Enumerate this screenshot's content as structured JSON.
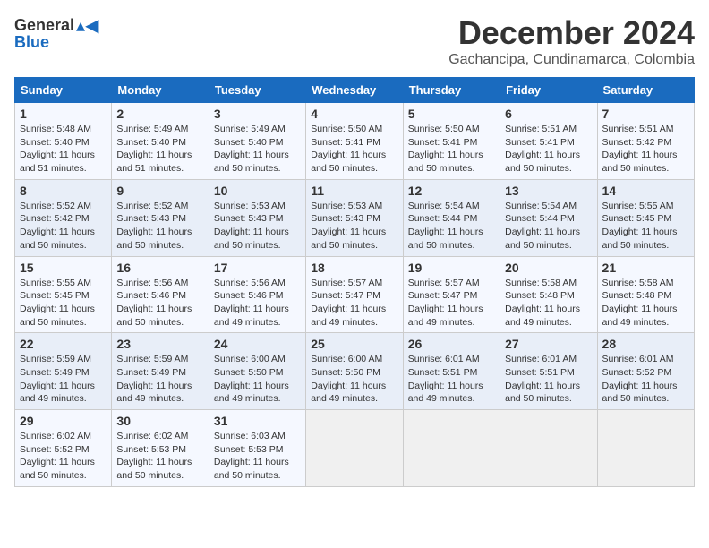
{
  "logo": {
    "general": "General",
    "blue": "Blue"
  },
  "header": {
    "month": "December 2024",
    "location": "Gachancipa, Cundinamarca, Colombia"
  },
  "weekdays": [
    "Sunday",
    "Monday",
    "Tuesday",
    "Wednesday",
    "Thursday",
    "Friday",
    "Saturday"
  ],
  "weeks": [
    [
      {
        "day": "1",
        "sunrise": "5:48 AM",
        "sunset": "5:40 PM",
        "daylight": "11 hours and 51 minutes."
      },
      {
        "day": "2",
        "sunrise": "5:49 AM",
        "sunset": "5:40 PM",
        "daylight": "11 hours and 51 minutes."
      },
      {
        "day": "3",
        "sunrise": "5:49 AM",
        "sunset": "5:40 PM",
        "daylight": "11 hours and 50 minutes."
      },
      {
        "day": "4",
        "sunrise": "5:50 AM",
        "sunset": "5:41 PM",
        "daylight": "11 hours and 50 minutes."
      },
      {
        "day": "5",
        "sunrise": "5:50 AM",
        "sunset": "5:41 PM",
        "daylight": "11 hours and 50 minutes."
      },
      {
        "day": "6",
        "sunrise": "5:51 AM",
        "sunset": "5:41 PM",
        "daylight": "11 hours and 50 minutes."
      },
      {
        "day": "7",
        "sunrise": "5:51 AM",
        "sunset": "5:42 PM",
        "daylight": "11 hours and 50 minutes."
      }
    ],
    [
      {
        "day": "8",
        "sunrise": "5:52 AM",
        "sunset": "5:42 PM",
        "daylight": "11 hours and 50 minutes."
      },
      {
        "day": "9",
        "sunrise": "5:52 AM",
        "sunset": "5:43 PM",
        "daylight": "11 hours and 50 minutes."
      },
      {
        "day": "10",
        "sunrise": "5:53 AM",
        "sunset": "5:43 PM",
        "daylight": "11 hours and 50 minutes."
      },
      {
        "day": "11",
        "sunrise": "5:53 AM",
        "sunset": "5:43 PM",
        "daylight": "11 hours and 50 minutes."
      },
      {
        "day": "12",
        "sunrise": "5:54 AM",
        "sunset": "5:44 PM",
        "daylight": "11 hours and 50 minutes."
      },
      {
        "day": "13",
        "sunrise": "5:54 AM",
        "sunset": "5:44 PM",
        "daylight": "11 hours and 50 minutes."
      },
      {
        "day": "14",
        "sunrise": "5:55 AM",
        "sunset": "5:45 PM",
        "daylight": "11 hours and 50 minutes."
      }
    ],
    [
      {
        "day": "15",
        "sunrise": "5:55 AM",
        "sunset": "5:45 PM",
        "daylight": "11 hours and 50 minutes."
      },
      {
        "day": "16",
        "sunrise": "5:56 AM",
        "sunset": "5:46 PM",
        "daylight": "11 hours and 50 minutes."
      },
      {
        "day": "17",
        "sunrise": "5:56 AM",
        "sunset": "5:46 PM",
        "daylight": "11 hours and 49 minutes."
      },
      {
        "day": "18",
        "sunrise": "5:57 AM",
        "sunset": "5:47 PM",
        "daylight": "11 hours and 49 minutes."
      },
      {
        "day": "19",
        "sunrise": "5:57 AM",
        "sunset": "5:47 PM",
        "daylight": "11 hours and 49 minutes."
      },
      {
        "day": "20",
        "sunrise": "5:58 AM",
        "sunset": "5:48 PM",
        "daylight": "11 hours and 49 minutes."
      },
      {
        "day": "21",
        "sunrise": "5:58 AM",
        "sunset": "5:48 PM",
        "daylight": "11 hours and 49 minutes."
      }
    ],
    [
      {
        "day": "22",
        "sunrise": "5:59 AM",
        "sunset": "5:49 PM",
        "daylight": "11 hours and 49 minutes."
      },
      {
        "day": "23",
        "sunrise": "5:59 AM",
        "sunset": "5:49 PM",
        "daylight": "11 hours and 49 minutes."
      },
      {
        "day": "24",
        "sunrise": "6:00 AM",
        "sunset": "5:50 PM",
        "daylight": "11 hours and 49 minutes."
      },
      {
        "day": "25",
        "sunrise": "6:00 AM",
        "sunset": "5:50 PM",
        "daylight": "11 hours and 49 minutes."
      },
      {
        "day": "26",
        "sunrise": "6:01 AM",
        "sunset": "5:51 PM",
        "daylight": "11 hours and 49 minutes."
      },
      {
        "day": "27",
        "sunrise": "6:01 AM",
        "sunset": "5:51 PM",
        "daylight": "11 hours and 50 minutes."
      },
      {
        "day": "28",
        "sunrise": "6:01 AM",
        "sunset": "5:52 PM",
        "daylight": "11 hours and 50 minutes."
      }
    ],
    [
      {
        "day": "29",
        "sunrise": "6:02 AM",
        "sunset": "5:52 PM",
        "daylight": "11 hours and 50 minutes."
      },
      {
        "day": "30",
        "sunrise": "6:02 AM",
        "sunset": "5:53 PM",
        "daylight": "11 hours and 50 minutes."
      },
      {
        "day": "31",
        "sunrise": "6:03 AM",
        "sunset": "5:53 PM",
        "daylight": "11 hours and 50 minutes."
      },
      null,
      null,
      null,
      null
    ]
  ]
}
